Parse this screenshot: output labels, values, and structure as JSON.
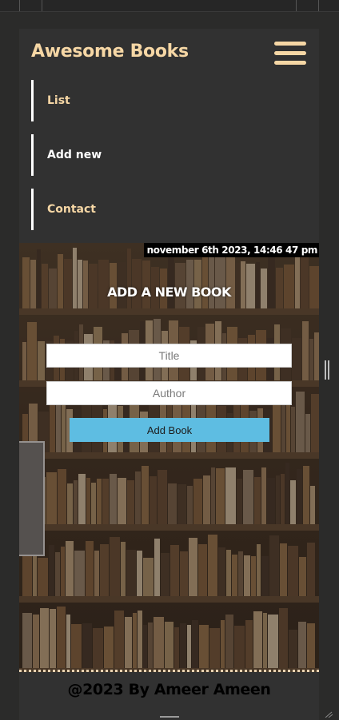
{
  "brand": {
    "title": "Awesome Books"
  },
  "nav": {
    "items": [
      {
        "label": "List",
        "color": "#f6d7a5"
      },
      {
        "label": "Add new",
        "color": "#ffffff"
      },
      {
        "label": "Contact",
        "color": "#f6d7a5"
      }
    ]
  },
  "clock": {
    "text": "november 6th 2023, 14:46 47 pm"
  },
  "form": {
    "heading": "ADD A NEW BOOK",
    "title_placeholder": "Title",
    "author_placeholder": "Author",
    "submit_label": "Add Book"
  },
  "footer": {
    "text": "@2023 By Ameer Ameen"
  },
  "colors": {
    "background": "#2b2b2a",
    "accent": "#f6d7a5",
    "button": "#5ebde2"
  }
}
